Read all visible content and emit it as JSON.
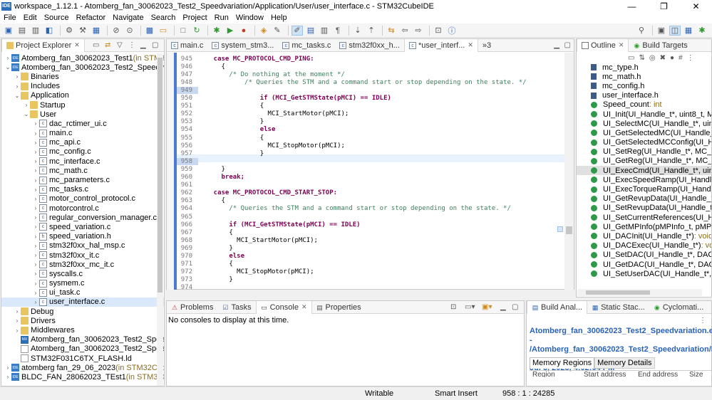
{
  "window": {
    "app_icon": "IDE",
    "title": "workspace_1.12.1 - Atomberg_fan_30062023_Test2_Speedvariation/Application/User/user_interface.c - STM32CubeIDE",
    "minimize": "—",
    "maximize": "❐",
    "close": "✕"
  },
  "menu": [
    "File",
    "Edit",
    "Source",
    "Refactor",
    "Navigate",
    "Search",
    "Project",
    "Run",
    "Window",
    "Help"
  ],
  "project_explorer": {
    "tab_label": "Project Explorer",
    "rows": [
      {
        "indent": 0,
        "arrow": ">",
        "icon": "proj",
        "label": "Atomberg_fan_30062023_Test1",
        "suffix": " (in STM32CubeIDE)"
      },
      {
        "indent": 0,
        "arrow": "v",
        "icon": "proj",
        "label": "Atomberg_fan_30062023_Test2_Speedvariation",
        "suffix": " (in STM32CubeIDE)"
      },
      {
        "indent": 1,
        "arrow": ">",
        "icon": "folder",
        "label": "Binaries",
        "suffix": ""
      },
      {
        "indent": 1,
        "arrow": ">",
        "icon": "folder",
        "label": "Includes",
        "suffix": ""
      },
      {
        "indent": 1,
        "arrow": "v",
        "icon": "folder",
        "label": "Application",
        "suffix": ""
      },
      {
        "indent": 2,
        "arrow": ">",
        "icon": "folder",
        "label": "Startup",
        "suffix": ""
      },
      {
        "indent": 2,
        "arrow": "v",
        "icon": "folder",
        "label": "User",
        "suffix": ""
      },
      {
        "indent": 3,
        "arrow": ">",
        "icon": "c",
        "label": "dac_rctimer_ui.c",
        "suffix": ""
      },
      {
        "indent": 3,
        "arrow": ">",
        "icon": "c",
        "label": "main.c",
        "suffix": ""
      },
      {
        "indent": 3,
        "arrow": ">",
        "icon": "c",
        "label": "mc_api.c",
        "suffix": ""
      },
      {
        "indent": 3,
        "arrow": ">",
        "icon": "c",
        "label": "mc_config.c",
        "suffix": ""
      },
      {
        "indent": 3,
        "arrow": ">",
        "icon": "c",
        "label": "mc_interface.c",
        "suffix": ""
      },
      {
        "indent": 3,
        "arrow": ">",
        "icon": "c",
        "label": "mc_math.c",
        "suffix": ""
      },
      {
        "indent": 3,
        "arrow": ">",
        "icon": "c",
        "label": "mc_parameters.c",
        "suffix": ""
      },
      {
        "indent": 3,
        "arrow": ">",
        "icon": "c",
        "label": "mc_tasks.c",
        "suffix": ""
      },
      {
        "indent": 3,
        "arrow": ">",
        "icon": "c",
        "label": "motor_control_protocol.c",
        "suffix": ""
      },
      {
        "indent": 3,
        "arrow": ">",
        "icon": "c",
        "label": "motorcontrol.c",
        "suffix": ""
      },
      {
        "indent": 3,
        "arrow": ">",
        "icon": "c",
        "label": "regular_conversion_manager.c",
        "suffix": ""
      },
      {
        "indent": 3,
        "arrow": ">",
        "icon": "c",
        "label": "speed_variation.c",
        "suffix": ""
      },
      {
        "indent": 3,
        "arrow": ">",
        "icon": "h",
        "label": "speed_variation.h",
        "suffix": ""
      },
      {
        "indent": 3,
        "arrow": ">",
        "icon": "c",
        "label": "stm32f0xx_hal_msp.c",
        "suffix": ""
      },
      {
        "indent": 3,
        "arrow": ">",
        "icon": "c",
        "label": "stm32f0xx_it.c",
        "suffix": ""
      },
      {
        "indent": 3,
        "arrow": ">",
        "icon": "c",
        "label": "stm32f0xx_mc_it.c",
        "suffix": ""
      },
      {
        "indent": 3,
        "arrow": ">",
        "icon": "c",
        "label": "syscalls.c",
        "suffix": ""
      },
      {
        "indent": 3,
        "arrow": ">",
        "icon": "c",
        "label": "sysmem.c",
        "suffix": ""
      },
      {
        "indent": 3,
        "arrow": ">",
        "icon": "c",
        "label": "ui_task.c",
        "suffix": ""
      },
      {
        "indent": 3,
        "arrow": ">",
        "icon": "c",
        "label": "user_interface.c",
        "suffix": "",
        "selected": true
      },
      {
        "indent": 1,
        "arrow": ">",
        "icon": "folder",
        "label": "Debug",
        "suffix": ""
      },
      {
        "indent": 1,
        "arrow": ">",
        "icon": "folder",
        "label": "Drivers",
        "suffix": ""
      },
      {
        "indent": 1,
        "arrow": ">",
        "icon": "folder",
        "label": "Middlewares",
        "suffix": ""
      },
      {
        "indent": 1,
        "arrow": "",
        "icon": "mx",
        "label": "Atomberg_fan_30062023_Test2_Speedvariation",
        "suffix": ""
      },
      {
        "indent": 1,
        "arrow": "",
        "icon": "file",
        "label": "Atomberg_fan_30062023_Test2_Speedvariation",
        "suffix": ""
      },
      {
        "indent": 1,
        "arrow": "",
        "icon": "file",
        "label": "STM32F031C6TX_FLASH.ld",
        "suffix": ""
      },
      {
        "indent": 0,
        "arrow": ">",
        "icon": "proj",
        "label": "atomberg fan_29_06_2023",
        "suffix": " (in STM32CubeIDE)"
      },
      {
        "indent": 0,
        "arrow": ">",
        "icon": "proj",
        "label": "BLDC_FAN_28062023_TEst1",
        "suffix": " (in STM32CubeIDE)"
      }
    ]
  },
  "editor": {
    "tabs": [
      "main.c",
      "system_stm3...",
      "mc_tasks.c",
      "stm32f0xx_h...",
      "*user_interf...",
      "»3"
    ],
    "lines": [
      {
        "n": "945",
        "code": "    case MC_PROTOCOL_CMD_PING:"
      },
      {
        "n": "946",
        "code": "      {"
      },
      {
        "n": "947",
        "code": "        /* Do nothing at the moment */"
      },
      {
        "n": "948",
        "code": "            /* Queries the STM and a command start or stop depending on the state. */"
      },
      {
        "n": "949",
        "code": ""
      },
      {
        "n": "950",
        "code": "                if (MCI_GetSTMState(pMCI) == IDLE)"
      },
      {
        "n": "951",
        "code": "                {"
      },
      {
        "n": "952",
        "code": "                  MCI_StartMotor(pMCI);"
      },
      {
        "n": "953",
        "code": "                }"
      },
      {
        "n": "954",
        "code": "                else"
      },
      {
        "n": "955",
        "code": "                {"
      },
      {
        "n": "956",
        "code": "                  MCI_StopMotor(pMCI);"
      },
      {
        "n": "957",
        "code": "                }"
      },
      {
        "n": "958",
        "code": ""
      },
      {
        "n": "959",
        "code": "      }"
      },
      {
        "n": "960",
        "code": "      break;"
      },
      {
        "n": "961",
        "code": ""
      },
      {
        "n": "962",
        "code": "    case MC_PROTOCOL_CMD_START_STOP:"
      },
      {
        "n": "963",
        "code": "      {"
      },
      {
        "n": "964",
        "code": "        /* Queries the STM and a command start or stop depending on the state. */"
      },
      {
        "n": "965",
        "code": ""
      },
      {
        "n": "966",
        "code": "        if (MCI_GetSTMState(pMCI) == IDLE)"
      },
      {
        "n": "967",
        "code": "        {"
      },
      {
        "n": "968",
        "code": "          MCI_StartMotor(pMCI);"
      },
      {
        "n": "969",
        "code": "        }"
      },
      {
        "n": "970",
        "code": "        else"
      },
      {
        "n": "971",
        "code": "        {"
      },
      {
        "n": "972",
        "code": "          MCI_StopMotor(pMCI);"
      },
      {
        "n": "973",
        "code": "        }"
      },
      {
        "n": "974",
        "code": ""
      }
    ]
  },
  "outline": {
    "tabs": [
      "Outline",
      "Build Targets"
    ],
    "rows": [
      {
        "kind": "h",
        "label": "mc_type.h",
        "type": ""
      },
      {
        "kind": "h",
        "label": "mc_math.h",
        "type": ""
      },
      {
        "kind": "h",
        "label": "mc_config.h",
        "type": ""
      },
      {
        "kind": "h",
        "label": "user_interface.h",
        "type": ""
      },
      {
        "kind": "g",
        "label": "Speed_count",
        "type": " : int"
      },
      {
        "kind": "g",
        "label": "UI_Init(UI_Handle_t*, uint8_t, MCI_Handle_t",
        "type": ""
      },
      {
        "kind": "g",
        "label": "UI_SelectMC(UI_Handle_t*, uint8_t)",
        "type": " : bool"
      },
      {
        "kind": "g",
        "label": "UI_GetSelectedMC(UI_Handle_t*)",
        "type": " : uint8_t"
      },
      {
        "kind": "g",
        "label": "UI_GetSelectedMCConfig(UI_Handle_t*)",
        "type": ""
      },
      {
        "kind": "g",
        "label": "UI_SetReg(UI_Handle_t*, MC_Protocol_REG",
        "type": ""
      },
      {
        "kind": "g",
        "label": "UI_GetReg(UI_Handle_t*, MC_Protocol_REG",
        "type": ""
      },
      {
        "kind": "g",
        "label": "UI_ExecCmd(UI_Handle_t*, uint8_t)",
        "type": " : bool",
        "selected": true
      },
      {
        "kind": "g",
        "label": "UI_ExecSpeedRamp(UI_Handle_t*, int32_t",
        "type": ""
      },
      {
        "kind": "g",
        "label": "UI_ExecTorqueRamp(UI_Handle_t*, int16_t",
        "type": ""
      },
      {
        "kind": "g",
        "label": "UI_GetRevupData(UI_Handle_t*, uint8_t, u",
        "type": ""
      },
      {
        "kind": "g",
        "label": "UI_SetRevupData(UI_Handle_t*, uint8_t, u",
        "type": ""
      },
      {
        "kind": "g",
        "label": "UI_SetCurrentReferences(UI_Handle_t*, i",
        "type": ""
      },
      {
        "kind": "g",
        "label": "UI_GetMPInfo(pMPInfo_t, pMPInfo_t)",
        "type": " : b"
      },
      {
        "kind": "g",
        "label": "UI_DACInit(UI_Handle_t*)",
        "type": " : void"
      },
      {
        "kind": "g",
        "label": "UI_DACExec(UI_Handle_t*)",
        "type": " : void"
      },
      {
        "kind": "g",
        "label": "UI_SetDAC(UI_Handle_t*, DAC_Channel_t, N",
        "type": ""
      },
      {
        "kind": "g",
        "label": "UI_GetDAC(UI_Handle_t*, DAC_Channel_t)",
        "type": ""
      },
      {
        "kind": "g",
        "label": "UI_SetUserDAC(UI_Handle_t*, DAC_UserCha",
        "type": ""
      }
    ]
  },
  "console": {
    "tabs": [
      "Problems",
      "Tasks",
      "Console",
      "Properties"
    ],
    "message": "No consoles to display at this time."
  },
  "build_analyzer": {
    "tabs": [
      "Build Anal...",
      "Static Stac...",
      "Cyclomati..."
    ],
    "title_line1": "Atomberg_fan_30062023_Test2_Speedvariation.elf -",
    "title_line2": "/Atomberg_fan_30062023_Test2_Speedvariation/Debug -",
    "title_line3": "Jul 3, 2023, 4:02:04 PM",
    "subtabs": [
      "Memory Regions",
      "Memory Details"
    ],
    "columns": [
      "Region",
      "Start address",
      "End address",
      "Size"
    ]
  },
  "status": {
    "mode": "Writable",
    "insert": "Smart Insert",
    "position": "958 : 1 : 24285"
  }
}
